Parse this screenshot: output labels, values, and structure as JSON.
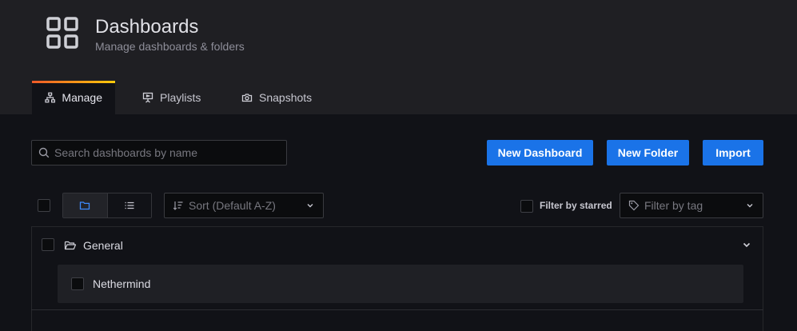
{
  "header": {
    "title": "Dashboards",
    "subtitle": "Manage dashboards & folders",
    "icon": "apps-grid-icon"
  },
  "tabs": [
    {
      "label": "Manage",
      "icon": "sitemap-icon",
      "active": true
    },
    {
      "label": "Playlists",
      "icon": "presentation-icon",
      "active": false
    },
    {
      "label": "Snapshots",
      "icon": "camera-icon",
      "active": false
    }
  ],
  "toolbar": {
    "search_placeholder": "Search dashboards by name",
    "new_dashboard": "New Dashboard",
    "new_folder": "New Folder",
    "import": "Import"
  },
  "filters": {
    "sort_placeholder": "Sort (Default A-Z)",
    "starred_label": "Filter by starred",
    "tag_placeholder": "Filter by tag"
  },
  "folders": [
    {
      "name": "General",
      "dashboards": [
        {
          "name": "Nethermind"
        }
      ]
    }
  ],
  "colors": {
    "primary": "#1a73e8",
    "background": "#111217",
    "header_bg": "#1f1f23",
    "tab_accent_start": "#f05a28",
    "tab_accent_end": "#fbca0a"
  }
}
